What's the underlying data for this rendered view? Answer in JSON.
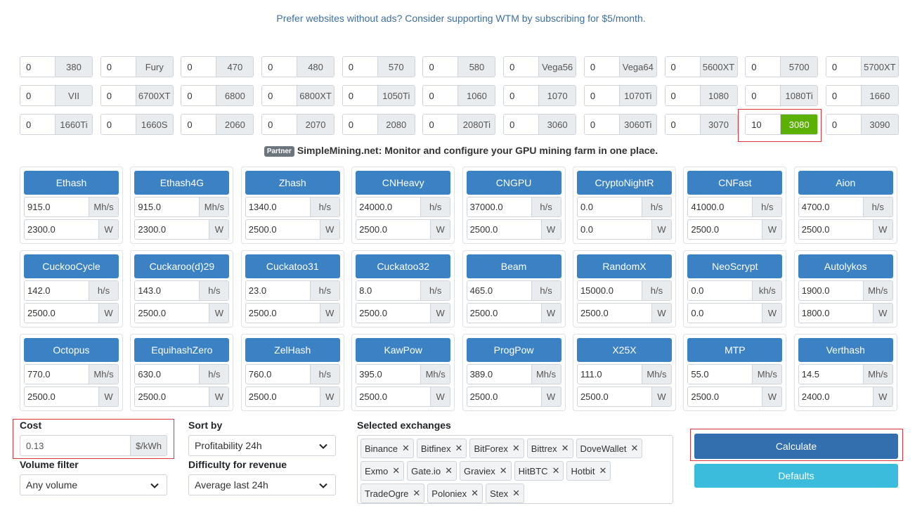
{
  "banner": "Prefer websites without ads? Consider supporting WTM by subscribing for $5/month.",
  "gpus": [
    {
      "qty": "0",
      "label": "380"
    },
    {
      "qty": "0",
      "label": "Fury"
    },
    {
      "qty": "0",
      "label": "470"
    },
    {
      "qty": "0",
      "label": "480"
    },
    {
      "qty": "0",
      "label": "570"
    },
    {
      "qty": "0",
      "label": "580"
    },
    {
      "qty": "0",
      "label": "Vega56"
    },
    {
      "qty": "0",
      "label": "Vega64"
    },
    {
      "qty": "0",
      "label": "5600XT"
    },
    {
      "qty": "0",
      "label": "5700"
    },
    {
      "qty": "0",
      "label": "5700XT"
    },
    {
      "qty": "0",
      "label": "VII"
    },
    {
      "qty": "0",
      "label": "6700XT"
    },
    {
      "qty": "0",
      "label": "6800"
    },
    {
      "qty": "0",
      "label": "6800XT"
    },
    {
      "qty": "0",
      "label": "1050Ti"
    },
    {
      "qty": "0",
      "label": "1060"
    },
    {
      "qty": "0",
      "label": "1070"
    },
    {
      "qty": "0",
      "label": "1070Ti"
    },
    {
      "qty": "0",
      "label": "1080"
    },
    {
      "qty": "0",
      "label": "1080Ti"
    },
    {
      "qty": "0",
      "label": "1660"
    },
    {
      "qty": "0",
      "label": "1660Ti"
    },
    {
      "qty": "0",
      "label": "1660S"
    },
    {
      "qty": "0",
      "label": "2060"
    },
    {
      "qty": "0",
      "label": "2070"
    },
    {
      "qty": "0",
      "label": "2080"
    },
    {
      "qty": "0",
      "label": "2080Ti"
    },
    {
      "qty": "0",
      "label": "3060"
    },
    {
      "qty": "0",
      "label": "3060Ti"
    },
    {
      "qty": "0",
      "label": "3070"
    },
    {
      "qty": "10",
      "label": "3080",
      "active": true
    },
    {
      "qty": "0",
      "label": "3090"
    }
  ],
  "partner": {
    "badge": "Partner",
    "text": "SimpleMining.net: Monitor and configure your GPU mining farm in one place."
  },
  "algorithms": [
    {
      "name": "Ethash",
      "hash": "915.0",
      "unit": "Mh/s",
      "power": "2300.0"
    },
    {
      "name": "Ethash4G",
      "hash": "915.0",
      "unit": "Mh/s",
      "power": "2300.0"
    },
    {
      "name": "Zhash",
      "hash": "1340.0",
      "unit": "h/s",
      "power": "2500.0"
    },
    {
      "name": "CNHeavy",
      "hash": "24000.0",
      "unit": "h/s",
      "power": "2500.0"
    },
    {
      "name": "CNGPU",
      "hash": "37000.0",
      "unit": "h/s",
      "power": "2500.0"
    },
    {
      "name": "CryptoNightR",
      "hash": "0.0",
      "unit": "h/s",
      "power": "0.0"
    },
    {
      "name": "CNFast",
      "hash": "41000.0",
      "unit": "h/s",
      "power": "2500.0"
    },
    {
      "name": "Aion",
      "hash": "4700.0",
      "unit": "h/s",
      "power": "2500.0"
    },
    {
      "name": "CuckooCycle",
      "hash": "142.0",
      "unit": "h/s",
      "power": "2500.0"
    },
    {
      "name": "Cuckaroo(d)29",
      "hash": "143.0",
      "unit": "h/s",
      "power": "2500.0"
    },
    {
      "name": "Cuckatoo31",
      "hash": "23.0",
      "unit": "h/s",
      "power": "2500.0"
    },
    {
      "name": "Cuckatoo32",
      "hash": "8.0",
      "unit": "h/s",
      "power": "2500.0"
    },
    {
      "name": "Beam",
      "hash": "465.0",
      "unit": "h/s",
      "power": "2500.0"
    },
    {
      "name": "RandomX",
      "hash": "15000.0",
      "unit": "h/s",
      "power": "2500.0"
    },
    {
      "name": "NeoScrypt",
      "hash": "0.0",
      "unit": "kh/s",
      "power": "0.0"
    },
    {
      "name": "Autolykos",
      "hash": "1900.0",
      "unit": "Mh/s",
      "power": "1800.0"
    },
    {
      "name": "Octopus",
      "hash": "770.0",
      "unit": "Mh/s",
      "power": "2500.0"
    },
    {
      "name": "EquihashZero",
      "hash": "630.0",
      "unit": "h/s",
      "power": "2500.0"
    },
    {
      "name": "ZelHash",
      "hash": "760.0",
      "unit": "h/s",
      "power": "2500.0"
    },
    {
      "name": "KawPow",
      "hash": "395.0",
      "unit": "Mh/s",
      "power": "2500.0"
    },
    {
      "name": "ProgPow",
      "hash": "389.0",
      "unit": "Mh/s",
      "power": "2500.0"
    },
    {
      "name": "X25X",
      "hash": "111.0",
      "unit": "Mh/s",
      "power": "2500.0"
    },
    {
      "name": "MTP",
      "hash": "55.0",
      "unit": "Mh/s",
      "power": "2500.0"
    },
    {
      "name": "Verthash",
      "hash": "14.5",
      "unit": "Mh/s",
      "power": "2400.0"
    }
  ],
  "power_unit": "W",
  "cost": {
    "label": "Cost",
    "value": "0.13",
    "unit": "$/kWh"
  },
  "volume_filter": {
    "label": "Volume filter",
    "value": "Any volume"
  },
  "sort_by": {
    "label": "Sort by",
    "value": "Profitability 24h"
  },
  "difficulty": {
    "label": "Difficulty for revenue",
    "value": "Average last 24h"
  },
  "exchanges": {
    "label": "Selected exchanges",
    "items": [
      "Binance",
      "Bitfinex",
      "BitForex",
      "Bittrex",
      "DoveWallet",
      "Exmo",
      "Gate.io",
      "Graviex",
      "HitBTC",
      "Hotbit",
      "TradeOgre",
      "Poloniex",
      "Stex"
    ]
  },
  "buttons": {
    "calculate": "Calculate",
    "defaults": "Defaults"
  },
  "colors": {
    "primary": "#3b82c4",
    "active_gpu": "#5cb000",
    "info": "#3bbcdc",
    "highlight": "#d9363e"
  }
}
